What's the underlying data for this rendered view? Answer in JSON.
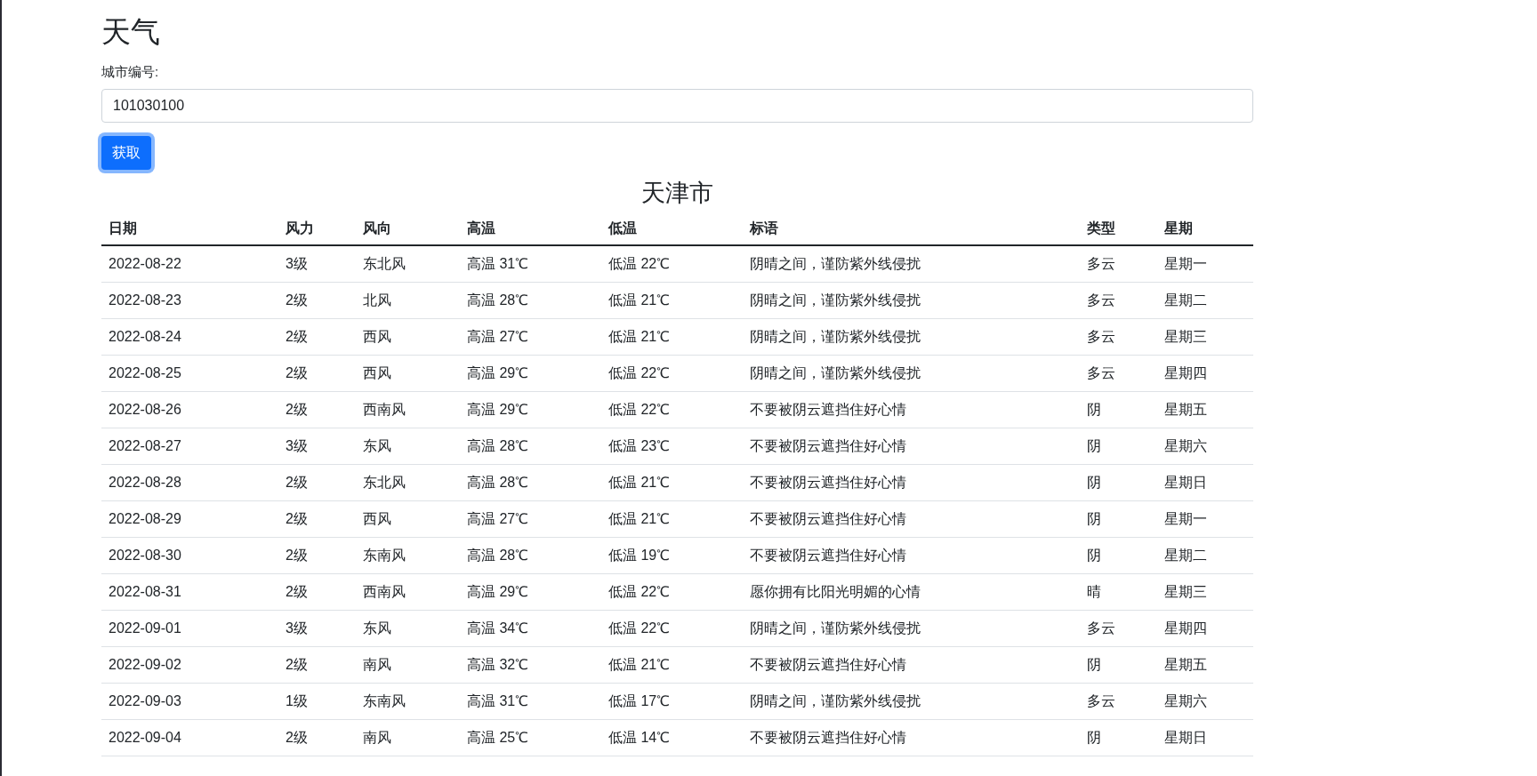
{
  "page_title": "天气",
  "city_field": {
    "label": "城市编号:",
    "value": "101030100"
  },
  "fetch_button": {
    "label": "获取",
    "focused": true
  },
  "city_name": "天津市",
  "table": {
    "columns": [
      "日期",
      "风力",
      "风向",
      "高温",
      "低温",
      "标语",
      "类型",
      "星期"
    ],
    "rows": [
      [
        "2022-08-22",
        "3级",
        "东北风",
        "高温 31℃",
        "低温 22℃",
        "阴晴之间，谨防紫外线侵扰",
        "多云",
        "星期一"
      ],
      [
        "2022-08-23",
        "2级",
        "北风",
        "高温 28℃",
        "低温 21℃",
        "阴晴之间，谨防紫外线侵扰",
        "多云",
        "星期二"
      ],
      [
        "2022-08-24",
        "2级",
        "西风",
        "高温 27℃",
        "低温 21℃",
        "阴晴之间，谨防紫外线侵扰",
        "多云",
        "星期三"
      ],
      [
        "2022-08-25",
        "2级",
        "西风",
        "高温 29℃",
        "低温 22℃",
        "阴晴之间，谨防紫外线侵扰",
        "多云",
        "星期四"
      ],
      [
        "2022-08-26",
        "2级",
        "西南风",
        "高温 29℃",
        "低温 22℃",
        "不要被阴云遮挡住好心情",
        "阴",
        "星期五"
      ],
      [
        "2022-08-27",
        "3级",
        "东风",
        "高温 28℃",
        "低温 23℃",
        "不要被阴云遮挡住好心情",
        "阴",
        "星期六"
      ],
      [
        "2022-08-28",
        "2级",
        "东北风",
        "高温 28℃",
        "低温 21℃",
        "不要被阴云遮挡住好心情",
        "阴",
        "星期日"
      ],
      [
        "2022-08-29",
        "2级",
        "西风",
        "高温 27℃",
        "低温 21℃",
        "不要被阴云遮挡住好心情",
        "阴",
        "星期一"
      ],
      [
        "2022-08-30",
        "2级",
        "东南风",
        "高温 28℃",
        "低温 19℃",
        "不要被阴云遮挡住好心情",
        "阴",
        "星期二"
      ],
      [
        "2022-08-31",
        "2级",
        "西南风",
        "高温 29℃",
        "低温 22℃",
        "愿你拥有比阳光明媚的心情",
        "晴",
        "星期三"
      ],
      [
        "2022-09-01",
        "3级",
        "东风",
        "高温 34℃",
        "低温 22℃",
        "阴晴之间，谨防紫外线侵扰",
        "多云",
        "星期四"
      ],
      [
        "2022-09-02",
        "2级",
        "南风",
        "高温 32℃",
        "低温 21℃",
        "不要被阴云遮挡住好心情",
        "阴",
        "星期五"
      ],
      [
        "2022-09-03",
        "1级",
        "东南风",
        "高温 31℃",
        "低温 17℃",
        "阴晴之间，谨防紫外线侵扰",
        "多云",
        "星期六"
      ],
      [
        "2022-09-04",
        "2级",
        "南风",
        "高温 25℃",
        "低温 14℃",
        "不要被阴云遮挡住好心情",
        "阴",
        "星期日"
      ]
    ]
  }
}
